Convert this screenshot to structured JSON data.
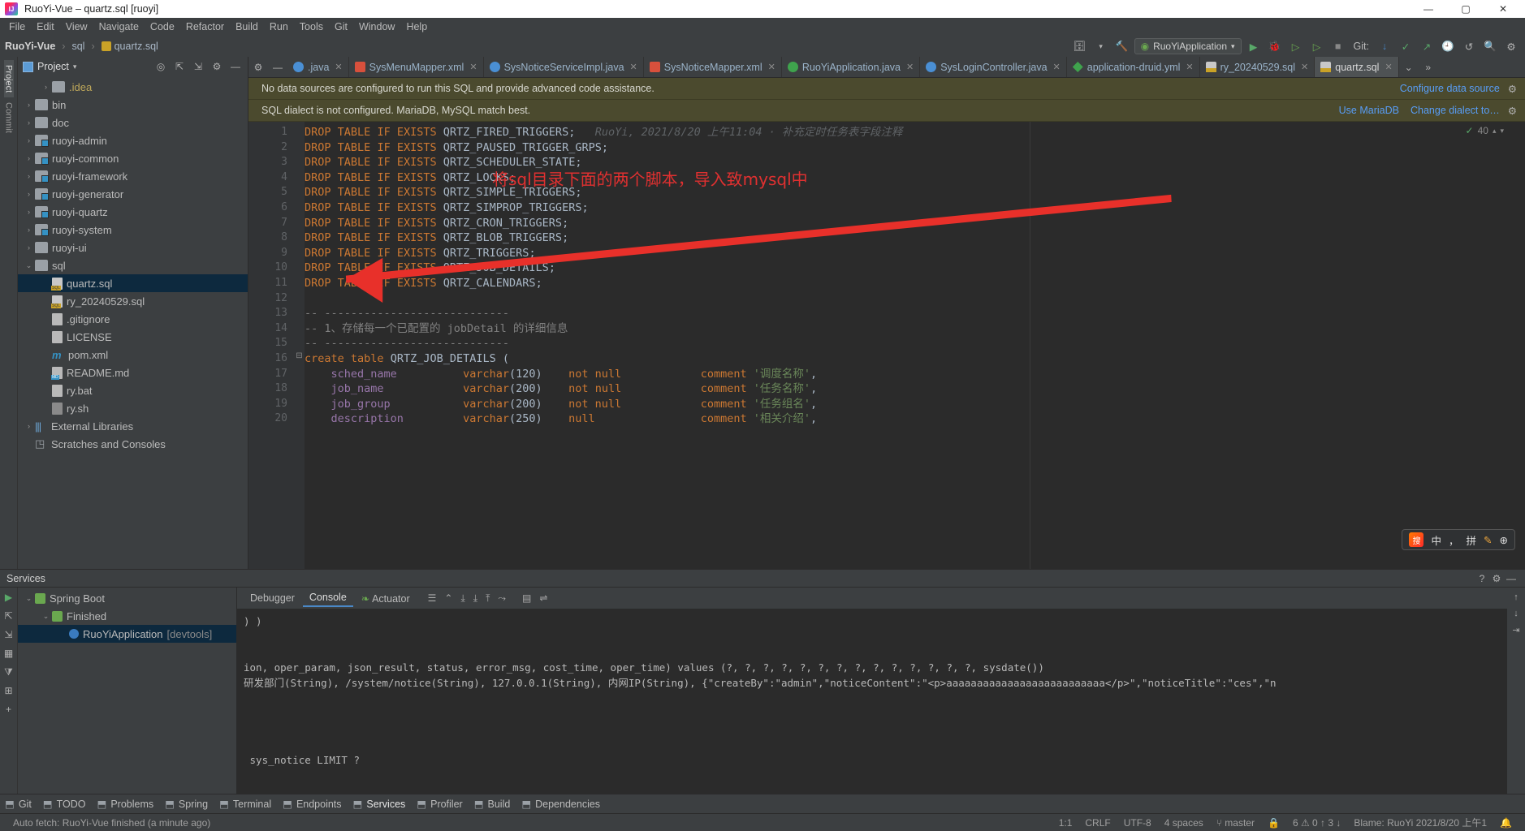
{
  "window": {
    "title": "RuoYi-Vue – quartz.sql [ruoyi]",
    "minimize": "—",
    "maximize": "▢",
    "close": "✕"
  },
  "menu": [
    "File",
    "Edit",
    "View",
    "Navigate",
    "Code",
    "Refactor",
    "Build",
    "Run",
    "Tools",
    "Git",
    "Window",
    "Help"
  ],
  "breadcrumb": {
    "project": "RuoYi-Vue",
    "folder": "sql",
    "file": "quartz.sql"
  },
  "toolbar": {
    "run_config": "RuoYiApplication",
    "git_label": "Git:",
    "icons": [
      "database-icon",
      "hammer-icon",
      "run-icon",
      "debug-icon",
      "coverage-icon",
      "profiler-icon",
      "stop-icon",
      "git-update-icon",
      "git-commit-icon",
      "git-push-icon",
      "git-history-icon",
      "git-rollback-icon",
      "search-icon",
      "settings-icon"
    ]
  },
  "project_panel": {
    "title": "Project",
    "header_icons": [
      "locate-icon",
      "expand-all-icon",
      "collapse-all-icon",
      "hide-icon"
    ],
    "items": [
      {
        "label": ".idea",
        "indent": 2,
        "arrow": "›",
        "icon": "folder",
        "color": "yellow"
      },
      {
        "label": "bin",
        "indent": 1,
        "arrow": "›",
        "icon": "folder"
      },
      {
        "label": "doc",
        "indent": 1,
        "arrow": "›",
        "icon": "folder"
      },
      {
        "label": "ruoyi-admin",
        "indent": 1,
        "arrow": "›",
        "icon": "folder-module"
      },
      {
        "label": "ruoyi-common",
        "indent": 1,
        "arrow": "›",
        "icon": "folder-module"
      },
      {
        "label": "ruoyi-framework",
        "indent": 1,
        "arrow": "›",
        "icon": "folder-module"
      },
      {
        "label": "ruoyi-generator",
        "indent": 1,
        "arrow": "›",
        "icon": "folder-module"
      },
      {
        "label": "ruoyi-quartz",
        "indent": 1,
        "arrow": "›",
        "icon": "folder-module"
      },
      {
        "label": "ruoyi-system",
        "indent": 1,
        "arrow": "›",
        "icon": "folder-module"
      },
      {
        "label": "ruoyi-ui",
        "indent": 1,
        "arrow": "›",
        "icon": "folder"
      },
      {
        "label": "sql",
        "indent": 1,
        "arrow": "⌄",
        "icon": "folder"
      },
      {
        "label": "quartz.sql",
        "indent": 2,
        "arrow": "",
        "icon": "sql-file",
        "selected": true
      },
      {
        "label": "ry_20240529.sql",
        "indent": 2,
        "arrow": "",
        "icon": "sql-file"
      },
      {
        "label": ".gitignore",
        "indent": 2,
        "arrow": "",
        "icon": "gitignore-file"
      },
      {
        "label": "LICENSE",
        "indent": 2,
        "arrow": "",
        "icon": "text-file"
      },
      {
        "label": "pom.xml",
        "indent": 2,
        "arrow": "",
        "icon": "maven-file"
      },
      {
        "label": "README.md",
        "indent": 2,
        "arrow": "",
        "icon": "md-file"
      },
      {
        "label": "ry.bat",
        "indent": 2,
        "arrow": "",
        "icon": "bat-file"
      },
      {
        "label": "ry.sh",
        "indent": 2,
        "arrow": "",
        "icon": "sh-file"
      },
      {
        "label": "External Libraries",
        "indent": 1,
        "arrow": "›",
        "icon": "library"
      },
      {
        "label": "Scratches and Consoles",
        "indent": 1,
        "arrow": "",
        "icon": "scratch"
      }
    ]
  },
  "left_rail": [
    "Project",
    "Commit"
  ],
  "editor_tabs": [
    {
      "label": ".java",
      "icon": "java",
      "active": false
    },
    {
      "label": "SysMenuMapper.xml",
      "icon": "xml",
      "active": false
    },
    {
      "label": "SysNoticeServiceImpl.java",
      "icon": "javac",
      "active": false
    },
    {
      "label": "SysNoticeMapper.xml",
      "icon": "xml",
      "active": false
    },
    {
      "label": "RuoYiApplication.java",
      "icon": "javac-green",
      "active": false
    },
    {
      "label": "SysLoginController.java",
      "icon": "javac",
      "active": false
    },
    {
      "label": "application-druid.yml",
      "icon": "yml",
      "active": false
    },
    {
      "label": "ry_20240529.sql",
      "icon": "sql",
      "active": false
    },
    {
      "label": "quartz.sql",
      "icon": "sql",
      "active": true
    }
  ],
  "notices": [
    {
      "text": "No data sources are configured to run this SQL and provide advanced code assistance.",
      "action": "Configure data source"
    },
    {
      "text": "SQL dialect is not configured. MariaDB, MySQL match best.",
      "action": "Use MariaDB",
      "action2": "Change dialect to…"
    }
  ],
  "inspection": {
    "count": "40",
    "check": "✓"
  },
  "code": {
    "annotation_line1": "RuoYi, 2021/8/20 上午11:04 · 补充定时任务表字段注释",
    "lines": [
      {
        "n": 1,
        "text": "DROP TABLE IF EXISTS QRTZ_FIRED_TRIGGERS;"
      },
      {
        "n": 2,
        "text": "DROP TABLE IF EXISTS QRTZ_PAUSED_TRIGGER_GRPS;"
      },
      {
        "n": 3,
        "text": "DROP TABLE IF EXISTS QRTZ_SCHEDULER_STATE;"
      },
      {
        "n": 4,
        "text": "DROP TABLE IF EXISTS QRTZ_LOCKS;"
      },
      {
        "n": 5,
        "text": "DROP TABLE IF EXISTS QRTZ_SIMPLE_TRIGGERS;"
      },
      {
        "n": 6,
        "text": "DROP TABLE IF EXISTS QRTZ_SIMPROP_TRIGGERS;"
      },
      {
        "n": 7,
        "text": "DROP TABLE IF EXISTS QRTZ_CRON_TRIGGERS;"
      },
      {
        "n": 8,
        "text": "DROP TABLE IF EXISTS QRTZ_BLOB_TRIGGERS;"
      },
      {
        "n": 9,
        "text": "DROP TABLE IF EXISTS QRTZ_TRIGGERS;"
      },
      {
        "n": 10,
        "text": "DROP TABLE IF EXISTS QRTZ_JOB_DETAILS;"
      },
      {
        "n": 11,
        "text": "DROP TABLE IF EXISTS QRTZ_CALENDARS;"
      },
      {
        "n": 12,
        "text": ""
      },
      {
        "n": 13,
        "text": "-- ----------------------------"
      },
      {
        "n": 14,
        "text": "-- 1、存储每一个已配置的 jobDetail 的详细信息"
      },
      {
        "n": 15,
        "text": "-- ----------------------------"
      },
      {
        "n": 16,
        "text": "create table QRTZ_JOB_DETAILS ("
      },
      {
        "n": 17,
        "text": "    sched_name          varchar(120)    not null            comment '调度名称',"
      },
      {
        "n": 18,
        "text": "    job_name            varchar(200)    not null            comment '任务名称',"
      },
      {
        "n": 19,
        "text": "    job_group           varchar(200)    not null            comment '任务组名',"
      },
      {
        "n": 20,
        "text": "    description         varchar(250)    null                comment '相关介绍',"
      }
    ]
  },
  "annotation": {
    "text": "将sql目录下面的两个脚本，导入致mysql中",
    "color": "#e03030"
  },
  "services": {
    "title": "Services",
    "tree": [
      {
        "label": "Spring Boot",
        "indent": 1,
        "arrow": "⌄",
        "icon": "spring"
      },
      {
        "label": "Finished",
        "indent": 2,
        "arrow": "⌄",
        "icon": "spring-group"
      },
      {
        "label": "RuoYiApplication",
        "suffix": "[devtools]",
        "indent": 3,
        "arrow": "",
        "icon": "app-running",
        "selected": true
      }
    ],
    "tabs": [
      {
        "label": "Debugger",
        "active": false
      },
      {
        "label": "Console",
        "active": true
      },
      {
        "label": "Actuator",
        "active": false
      }
    ],
    "console_lines": [
      ") )",
      "",
      "",
      "ion, oper_param, json_result, status, error_msg, cost_time, oper_time) values (?, ?, ?, ?, ?, ?, ?, ?, ?, ?, ?, ?, ?, ?, sysdate())",
      "研发部门(String), /system/notice(String), 127.0.0.1(String), 内网IP(String), {\"createBy\":\"admin\",\"noticeContent\":\"<p>aaaaaaaaaaaaaaaaaaaaaaaaaa</p>\",\"noticeTitle\":\"ces\",\"n",
      "",
      "",
      "",
      "",
      " sys_notice LIMIT ?"
    ]
  },
  "ime": {
    "logo": "搜",
    "lang": "中",
    "punct": "，",
    "mode": "拼",
    "pen": "✎",
    "more": "⊕"
  },
  "toolwindows": [
    {
      "label": "Git",
      "icon": "git-icon"
    },
    {
      "label": "TODO",
      "icon": "todo-icon"
    },
    {
      "label": "Problems",
      "icon": "problems-icon"
    },
    {
      "label": "Spring",
      "icon": "spring-icon"
    },
    {
      "label": "Terminal",
      "icon": "terminal-icon"
    },
    {
      "label": "Endpoints",
      "icon": "endpoints-icon"
    },
    {
      "label": "Services",
      "icon": "services-icon",
      "active": true
    },
    {
      "label": "Profiler",
      "icon": "profiler-icon"
    },
    {
      "label": "Build",
      "icon": "build-icon"
    },
    {
      "label": "Dependencies",
      "icon": "dependencies-icon"
    }
  ],
  "statusbar": {
    "message": "Auto fetch: RuoYi-Vue finished (a minute ago)",
    "caret": "1:1",
    "line_sep": "CRLF",
    "encoding": "UTF-8",
    "indent": "4 spaces",
    "branch": "master",
    "inspections": "6 ⚠ 0 ↑ 3 ↓",
    "blame": "Blame: RuoYi 2021/8/20 上午1"
  }
}
